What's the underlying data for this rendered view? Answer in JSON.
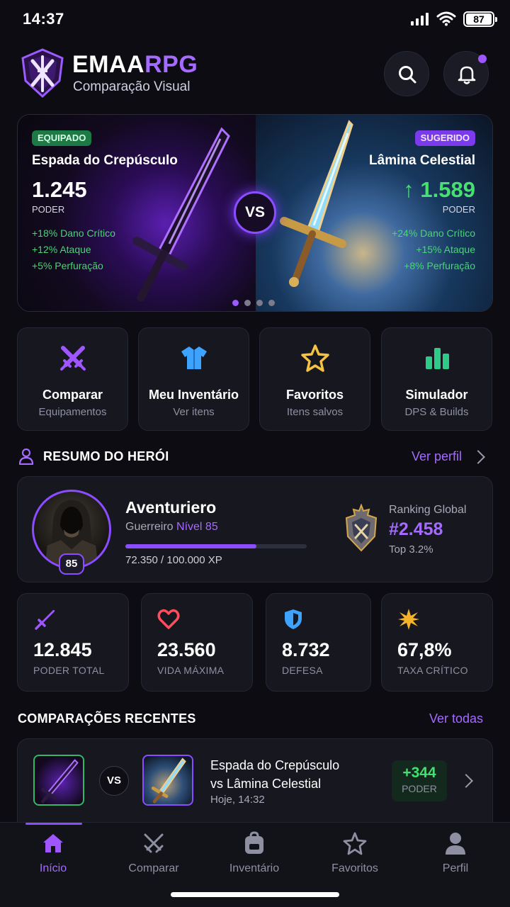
{
  "status": {
    "time": "14:37",
    "battery": "87"
  },
  "header": {
    "brand_main": "EMAA",
    "brand_accent": "RPG",
    "subtitle": "Comparação Visual"
  },
  "compare": {
    "left": {
      "badge": "EQUIPADO",
      "name": "Espada do Crepúsculo",
      "power": "1.245",
      "power_label": "PODER",
      "stats": [
        "+18% Dano Crítico",
        "+12% Ataque",
        "+5% Perfuração"
      ]
    },
    "right": {
      "badge": "SUGERIDO",
      "name": "Lâmina Celestial",
      "power": "↑ 1.589",
      "power_label": "PODER",
      "stats": [
        "+24% Dano Crítico",
        "+15% Ataque",
        "+8% Perfuração"
      ]
    },
    "vs": "VS",
    "carousel": {
      "pages": 4,
      "active": 1
    }
  },
  "quick_actions": [
    {
      "title": "Comparar",
      "subtitle": "Equipamentos",
      "icon": "crossed-swords-icon",
      "color": "#a056ff"
    },
    {
      "title": "Meu Inventário",
      "subtitle": "Ver itens",
      "icon": "shirt-icon",
      "color": "#3da3ff"
    },
    {
      "title": "Favoritos",
      "subtitle": "Itens salvos",
      "icon": "star-icon",
      "color": "#f5c242"
    },
    {
      "title": "Simulador",
      "subtitle": "DPS & Builds",
      "icon": "bar-chart-icon",
      "color": "#2fc98a"
    }
  ],
  "hero_summary": {
    "section_title": "RESUMO DO HERÓI",
    "link": "Ver perfil",
    "name": "Aventuriero",
    "class": "Guerreiro",
    "level_text": "Nível 85",
    "level_badge": "85",
    "xp_text": "72.350 / 100.000 XP",
    "xp_progress": 0.7235,
    "ranking_label": "Ranking Global",
    "ranking_value": "#2.458",
    "ranking_top": "Top 3.2%"
  },
  "stats": [
    {
      "value": "12.845",
      "label": "PODER TOTAL",
      "icon": "sword-icon",
      "color": "#a056ff"
    },
    {
      "value": "23.560",
      "label": "VIDA MÁXIMA",
      "icon": "heart-icon",
      "color": "#ff4d5e"
    },
    {
      "value": "8.732",
      "label": "DEFESA",
      "icon": "shield-icon",
      "color": "#3da3ff"
    },
    {
      "value": "67,8%",
      "label": "TAXA CRÍTICO",
      "icon": "burst-icon",
      "color": "#f5b32a"
    }
  ],
  "recent": {
    "section_title": "COMPARAÇÕES RECENTES",
    "link": "Ver todas",
    "vs": "VS",
    "title_line1": "Espada do Crepúsculo",
    "title_line2": "vs Lâmina Celestial",
    "date": "Hoje, 14:32",
    "delta": "+344",
    "delta_label": "PODER"
  },
  "nav": [
    {
      "label": "Início",
      "icon": "home-icon",
      "active": true
    },
    {
      "label": "Comparar",
      "icon": "crossed-swords-icon",
      "active": false
    },
    {
      "label": "Inventário",
      "icon": "backpack-icon",
      "active": false
    },
    {
      "label": "Favoritos",
      "icon": "star-icon",
      "active": false
    },
    {
      "label": "Perfil",
      "icon": "user-icon",
      "active": false
    }
  ]
}
